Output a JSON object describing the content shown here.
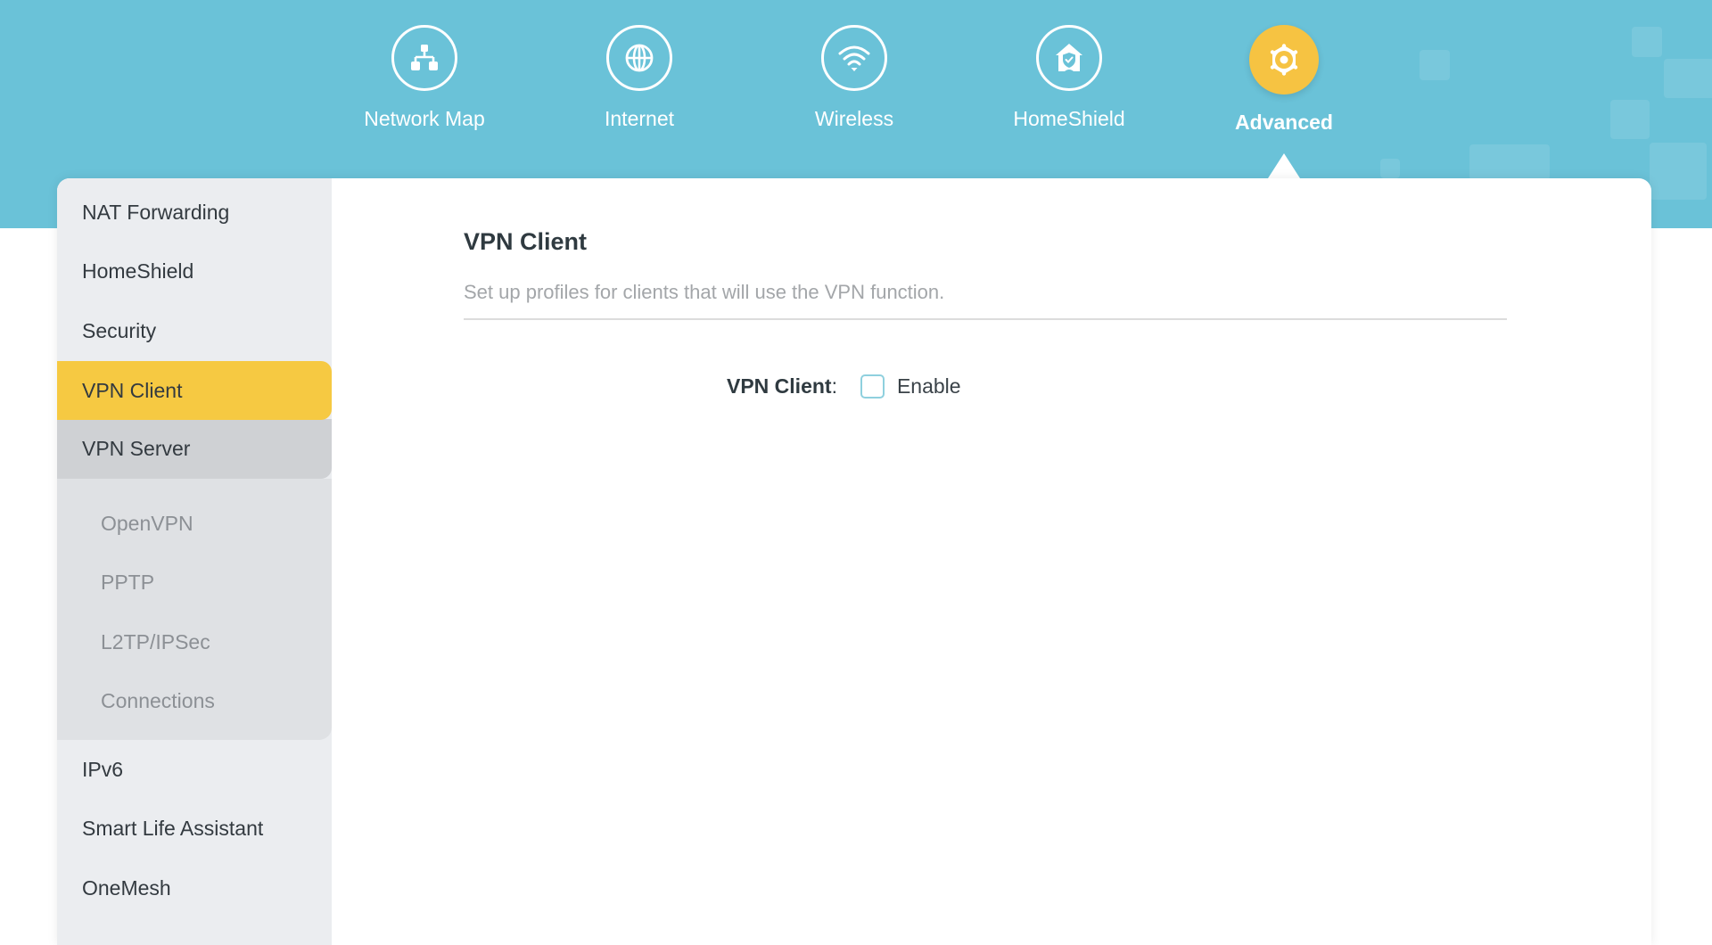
{
  "colors": {
    "header_bg": "#6ac2d8",
    "accent_yellow": "#f6c942",
    "sidebar_bg": "#ebedf0",
    "checkbox_border": "#8fd0de"
  },
  "top_nav": {
    "items": [
      {
        "label": "Network Map",
        "icon": "network-map-icon",
        "active": false
      },
      {
        "label": "Internet",
        "icon": "globe-icon",
        "active": false
      },
      {
        "label": "Wireless",
        "icon": "wifi-icon",
        "active": false
      },
      {
        "label": "HomeShield",
        "icon": "home-shield-icon",
        "active": false
      },
      {
        "label": "Advanced",
        "icon": "gear-icon",
        "active": true
      }
    ]
  },
  "sidebar": {
    "items": [
      {
        "label": "NAT Forwarding"
      },
      {
        "label": "HomeShield"
      },
      {
        "label": "Security"
      },
      {
        "label": "VPN Client",
        "state": "active"
      },
      {
        "label": "VPN Server",
        "state": "expanded"
      },
      {
        "label": "IPv6"
      },
      {
        "label": "Smart Life Assistant"
      },
      {
        "label": "OneMesh"
      }
    ],
    "vpn_server_subitems": [
      {
        "label": "OpenVPN"
      },
      {
        "label": "PPTP"
      },
      {
        "label": "L2TP/IPSec"
      },
      {
        "label": "Connections"
      }
    ]
  },
  "main": {
    "title": "VPN Client",
    "subtitle": "Set up profiles for clients that will use the VPN function.",
    "form": {
      "field_label": "VPN Client",
      "colon": ":",
      "checkbox_label": "Enable",
      "checkbox_checked": false
    }
  }
}
